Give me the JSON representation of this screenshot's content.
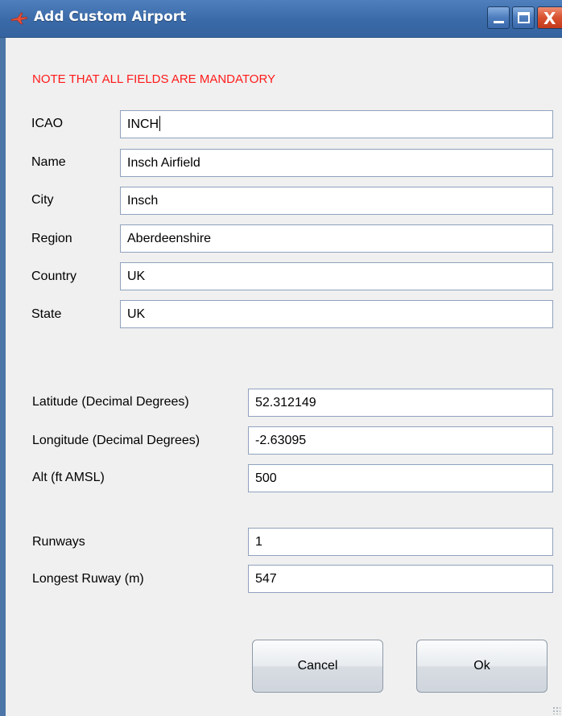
{
  "window": {
    "title": "Add Custom Airport",
    "controls": {
      "minimize": "minimize",
      "maximize": "maximize",
      "close": "X"
    }
  },
  "note": "NOTE THAT ALL FIELDS ARE MANDATORY",
  "fields": {
    "icao": {
      "label": "ICAO",
      "value": "INCH"
    },
    "name": {
      "label": "Name",
      "value": "Insch Airfield"
    },
    "city": {
      "label": "City",
      "value": "Insch"
    },
    "region": {
      "label": "Region",
      "value": "Aberdeenshire"
    },
    "country": {
      "label": "Country",
      "value": "UK"
    },
    "state": {
      "label": "State",
      "value": "UK"
    },
    "latitude": {
      "label": "Latitude (Decimal Degrees)",
      "value": "52.312149"
    },
    "longitude": {
      "label": "Longitude (Decimal Degrees)",
      "value": "-2.63095"
    },
    "altitude": {
      "label": "Alt (ft AMSL)",
      "value": "500"
    },
    "runways": {
      "label": "Runways",
      "value": "1"
    },
    "longest_runway": {
      "label": "Longest Ruway (m)",
      "value": "547"
    }
  },
  "buttons": {
    "cancel": "Cancel",
    "ok": "Ok"
  },
  "colors": {
    "titlebar": "#3a6aa8",
    "note": "#ff1a1a",
    "background": "#f0f0f0"
  }
}
